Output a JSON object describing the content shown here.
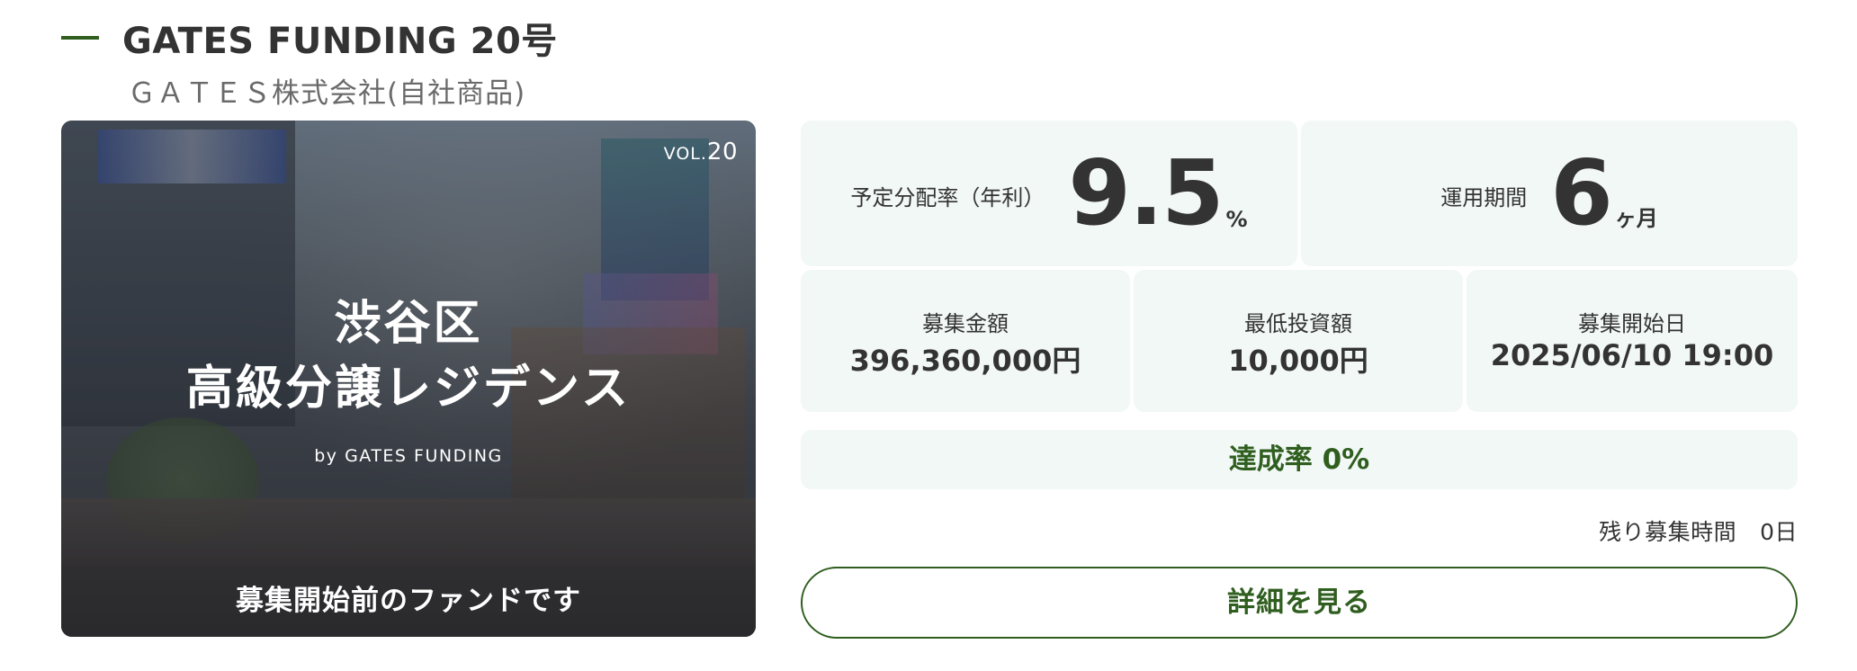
{
  "header": {
    "title": "GATES FUNDING 20号",
    "subtitle": "ＧＡＴＥＳ株式会社(自社商品)"
  },
  "hero": {
    "vol_prefix": "VOL.",
    "vol_number": "20",
    "title_line1": "渋谷区",
    "title_line2": "高級分譲レジデンス",
    "by_text": "by GATES FUNDING",
    "banner": "募集開始前のファンドです"
  },
  "stats": {
    "rate": {
      "label": "予定分配率（年利）",
      "value": "9.5",
      "unit": "%"
    },
    "period": {
      "label": "運用期間",
      "value": "6",
      "unit": "ヶ月"
    },
    "amount": {
      "label": "募集金額",
      "value": "396,360,000円"
    },
    "min_invest": {
      "label": "最低投資額",
      "value": "10,000円"
    },
    "start_date": {
      "label": "募集開始日",
      "value": "2025/06/10 19:00"
    }
  },
  "achievement": {
    "text": "達成率 0%",
    "percent": 0
  },
  "remaining": {
    "label": "残り募集時間",
    "value": "0日"
  },
  "detail_button": {
    "label": "詳細を見る"
  },
  "colors": {
    "accent": "#2f5e1f",
    "stat_bg": "#f2f8f5",
    "text": "#333333"
  }
}
